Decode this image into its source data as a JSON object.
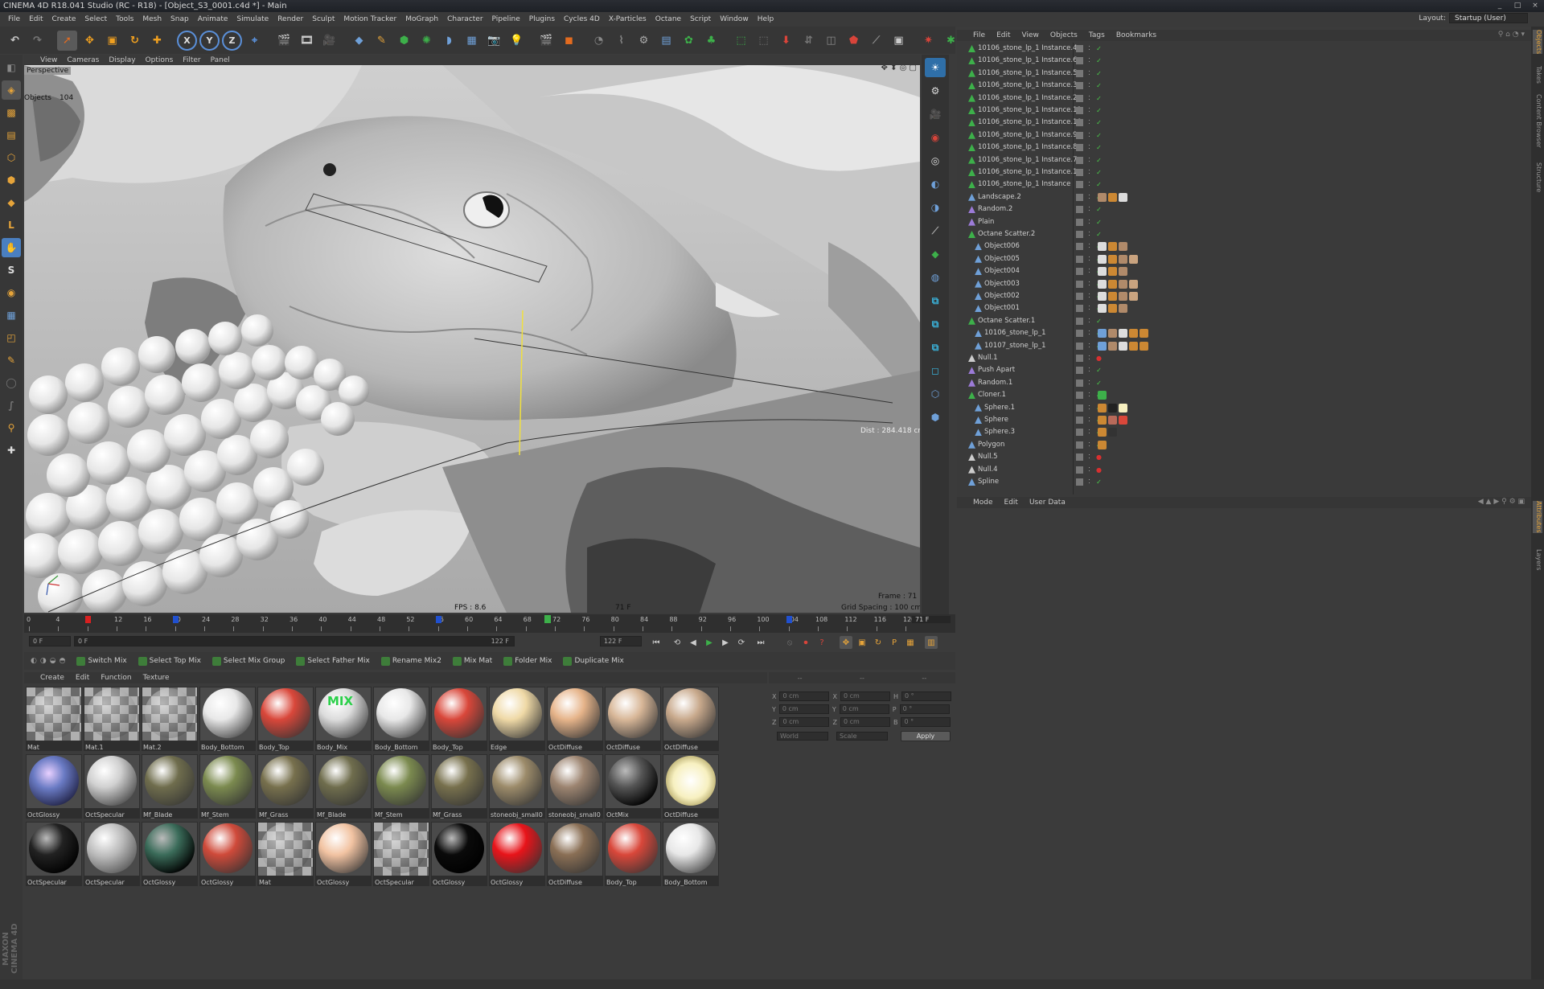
{
  "titlebar": {
    "title": "CINEMA 4D R18.041 Studio (RC - R18) - [Object_S3_0001.c4d *] - Main",
    "controls": [
      "_",
      "□",
      "×"
    ]
  },
  "menu": [
    "File",
    "Edit",
    "Create",
    "Select",
    "Tools",
    "Mesh",
    "Snap",
    "Animate",
    "Simulate",
    "Render",
    "Sculpt",
    "Motion Tracker",
    "MoGraph",
    "Character",
    "Pipeline",
    "Plugins",
    "Cycles 4D",
    "X-Particles",
    "Octane",
    "Script",
    "Window",
    "Help"
  ],
  "layout": {
    "label": "Layout:",
    "value": "Startup (User)"
  },
  "toolbar": {
    "axes": [
      "X",
      "Y",
      "Z"
    ]
  },
  "viewport": {
    "menu": [
      "View",
      "Cameras",
      "Display",
      "Options",
      "Filter",
      "Panel"
    ],
    "label": "Perspective",
    "hud_objects": "Objects",
    "hud_objects_count": "104",
    "dist": "Dist : 284.418 cm",
    "fps": "FPS : 8.6",
    "frame_mid": "71 F",
    "frame": "Frame : 71",
    "grid_spacing": "Grid Spacing : 100 cm"
  },
  "timeline": {
    "ticks": [
      "0",
      "4",
      "8",
      "12",
      "16",
      "20",
      "24",
      "28",
      "32",
      "36",
      "40",
      "44",
      "48",
      "52",
      "56",
      "60",
      "64",
      "68",
      "72",
      "76",
      "80",
      "84",
      "88",
      "92",
      "96",
      "100",
      "104",
      "108",
      "112",
      "116",
      "120"
    ],
    "current_frame": "71 F",
    "current_tick": "71",
    "key_red": 8,
    "key_blue_1": 20,
    "key_blue_2": 56,
    "key_blue_3": 104,
    "max_frame": 120,
    "current_value": 71
  },
  "transport": {
    "start": "0 F",
    "range_start": "0 F",
    "range_end": "122 F",
    "end": "122 F"
  },
  "mixbar": [
    "Switch Mix",
    "Select Top Mix",
    "Select Mix Group",
    "Select Father Mix",
    "Rename Mix2",
    "Mix Mat",
    "Folder Mix",
    "Duplicate Mix"
  ],
  "materials": {
    "menu": [
      "Create",
      "Edit",
      "Function",
      "Texture"
    ],
    "items": [
      {
        "name": "Mat",
        "color": "#8d8d8d",
        "type": "checker"
      },
      {
        "name": "Mat.1",
        "color": "#8d8d8d",
        "type": "checker"
      },
      {
        "name": "Mat.2",
        "color": "#8d8d8d",
        "type": "checker"
      },
      {
        "name": "Body_Bottom",
        "color": "#e8e8e8",
        "type": "rough"
      },
      {
        "name": "Body_Top",
        "color": "#d9473a",
        "type": "rough"
      },
      {
        "name": "Body_Mix",
        "color": "#dcdcdc",
        "type": "mix",
        "label": "MIX"
      },
      {
        "name": "Body_Bottom",
        "color": "#e8e8e8",
        "type": "rough"
      },
      {
        "name": "Body_Top",
        "color": "#d9473a",
        "type": "rough"
      },
      {
        "name": "Edge",
        "color": "#efd9a6",
        "type": "rough"
      },
      {
        "name": "OctDiffuse",
        "color": "#e6b48a",
        "type": "ball"
      },
      {
        "name": "OctDiffuse",
        "color": "#d8b798",
        "type": "ball"
      },
      {
        "name": "OctDiffuse",
        "color": "#c8a98c",
        "type": "ball"
      },
      {
        "name": "OctGlossy",
        "color": "#6a7bc4",
        "type": "space"
      },
      {
        "name": "OctSpecular",
        "color": "#d0d0d0",
        "type": "rough"
      },
      {
        "name": "Mf_Blade",
        "color": "#6f6d4d",
        "type": "ball"
      },
      {
        "name": "Mf_Stem",
        "color": "#7b8a4f",
        "type": "ball"
      },
      {
        "name": "Mf_Grass",
        "color": "#77704d",
        "type": "ball"
      },
      {
        "name": "Mf_Blade",
        "color": "#6f6d4d",
        "type": "ball"
      },
      {
        "name": "Mf_Stem",
        "color": "#7b8a4f",
        "type": "ball"
      },
      {
        "name": "Mf_Grass",
        "color": "#77704d",
        "type": "ball"
      },
      {
        "name": "stoneobj_small0",
        "color": "#9c8b6a",
        "type": "ball"
      },
      {
        "name": "stoneobj_small0",
        "color": "#9c8470",
        "type": "ball"
      },
      {
        "name": "OctMix",
        "color": "#555",
        "type": "dark"
      },
      {
        "name": "OctDiffuse",
        "color": "#f7f0c0",
        "type": "glow"
      },
      {
        "name": "OctSpecular",
        "color": "#222",
        "type": "dark"
      },
      {
        "name": "OctSpecular",
        "color": "#b8b8b8",
        "type": "glass"
      },
      {
        "name": "OctGlossy",
        "color": "#3b6c5a",
        "type": "dark"
      },
      {
        "name": "OctGlossy",
        "color": "#cf4a3a",
        "type": "ball"
      },
      {
        "name": "Mat",
        "color": "#8d8d8d",
        "type": "checker"
      },
      {
        "name": "OctGlossy",
        "color": "#f2c3a2",
        "type": "ball"
      },
      {
        "name": "OctSpecular",
        "color": "#8d8d8d",
        "type": "checker"
      },
      {
        "name": "OctGlossy",
        "color": "#0a0a0a",
        "type": "dark"
      },
      {
        "name": "OctGlossy",
        "color": "#e8141a",
        "type": "ball"
      },
      {
        "name": "OctDiffuse",
        "color": "#8a6f55",
        "type": "rough"
      },
      {
        "name": "Body_Top",
        "color": "#d9473a",
        "type": "rough"
      },
      {
        "name": "Body_Bottom",
        "color": "#e8e8e8",
        "type": "rough"
      }
    ]
  },
  "coords": {
    "header": [
      "--",
      "--",
      "--"
    ],
    "rows": [
      {
        "a": "X",
        "av": "0 cm",
        "b": "X",
        "bv": "0 cm",
        "c": "H",
        "cv": "0 °"
      },
      {
        "a": "Y",
        "av": "0 cm",
        "b": "Y",
        "bv": "0 cm",
        "c": "P",
        "cv": "0 °"
      },
      {
        "a": "Z",
        "av": "0 cm",
        "b": "Z",
        "bv": "0 cm",
        "c": "B",
        "cv": "0 °"
      }
    ],
    "world": "World",
    "scale": "Scale",
    "apply": "Apply"
  },
  "objects": {
    "menu": [
      "File",
      "Edit",
      "View",
      "Objects",
      "Tags",
      "Bookmarks"
    ],
    "rows": [
      {
        "name": "10106_stone_lp_1 Instance.4",
        "indent": 1,
        "icon": "#3db04a",
        "check": "✓"
      },
      {
        "name": "10106_stone_lp_1 Instance.6",
        "indent": 1,
        "icon": "#3db04a",
        "check": "✓"
      },
      {
        "name": "10106_stone_lp_1 Instance.5",
        "indent": 1,
        "icon": "#3db04a",
        "check": "✓"
      },
      {
        "name": "10106_stone_lp_1 Instance.3",
        "indent": 1,
        "icon": "#3db04a",
        "check": "✓"
      },
      {
        "name": "10106_stone_lp_1 Instance.2",
        "indent": 1,
        "icon": "#3db04a",
        "check": "✓"
      },
      {
        "name": "10106_stone_lp_1 Instance.11",
        "indent": 1,
        "icon": "#3db04a",
        "check": "✓"
      },
      {
        "name": "10106_stone_lp_1 Instance.10",
        "indent": 1,
        "icon": "#3db04a",
        "check": "✓"
      },
      {
        "name": "10106_stone_lp_1 Instance.9",
        "indent": 1,
        "icon": "#3db04a",
        "check": "✓"
      },
      {
        "name": "10106_stone_lp_1 Instance.8",
        "indent": 1,
        "icon": "#3db04a",
        "check": "✓"
      },
      {
        "name": "10106_stone_lp_1 Instance.7",
        "indent": 1,
        "icon": "#3db04a",
        "check": "✓"
      },
      {
        "name": "10106_stone_lp_1 Instance.1",
        "indent": 1,
        "icon": "#3db04a",
        "check": "✓"
      },
      {
        "name": "10106_stone_lp_1 Instance",
        "indent": 1,
        "icon": "#3db04a",
        "check": "✓"
      },
      {
        "name": "Landscape.2",
        "indent": 1,
        "icon": "#6fa0d8",
        "check": "✓",
        "tags": [
          "#b08a6a",
          "#cc8833",
          "#ddd"
        ]
      },
      {
        "name": "Random.2",
        "indent": 1,
        "icon": "#9c7bd8",
        "check": "✓"
      },
      {
        "name": "Plain",
        "indent": 1,
        "icon": "#9c7bd8",
        "check": "✓"
      },
      {
        "name": "Octane Scatter.2",
        "indent": 1,
        "icon": "#3db04a",
        "check": "✓"
      },
      {
        "name": "Object006",
        "indent": 2,
        "icon": "#6fa0d8",
        "check": "✓",
        "tags": [
          "#ddd",
          "#cc8833",
          "#b08a6a"
        ]
      },
      {
        "name": "Object005",
        "indent": 2,
        "icon": "#6fa0d8",
        "check": "✓",
        "tags": [
          "#ddd",
          "#cc8833",
          "#b08a6a",
          "#c9a37f"
        ]
      },
      {
        "name": "Object004",
        "indent": 2,
        "icon": "#6fa0d8",
        "check": "✓",
        "tags": [
          "#ddd",
          "#cc8833",
          "#b08a6a"
        ]
      },
      {
        "name": "Object003",
        "indent": 2,
        "icon": "#6fa0d8",
        "check": "✓",
        "tags": [
          "#ddd",
          "#cc8833",
          "#b08a6a",
          "#c9a37f"
        ]
      },
      {
        "name": "Object002",
        "indent": 2,
        "icon": "#6fa0d8",
        "check": "✓",
        "tags": [
          "#ddd",
          "#cc8833",
          "#b08a6a",
          "#c9a37f"
        ]
      },
      {
        "name": "Object001",
        "indent": 2,
        "icon": "#6fa0d8",
        "check": "✓",
        "tags": [
          "#ddd",
          "#cc8833",
          "#b08a6a"
        ]
      },
      {
        "name": "Octane Scatter.1",
        "indent": 1,
        "icon": "#3db04a",
        "check": "✓"
      },
      {
        "name": "10106_stone_lp_1",
        "indent": 2,
        "icon": "#6fa0d8",
        "check": "✓",
        "tags": [
          "#6fa0d8",
          "#b08a6a",
          "#ddd",
          "#cc8833",
          "#cc8833"
        ]
      },
      {
        "name": "10107_stone_lp_1",
        "indent": 2,
        "icon": "#6fa0d8",
        "check": "✓",
        "tags": [
          "#6fa0d8",
          "#b08a6a",
          "#ddd",
          "#cc8833",
          "#cc8833"
        ]
      },
      {
        "name": "Null.1",
        "indent": 1,
        "icon": "#cccccc",
        "check": "●"
      },
      {
        "name": "Push Apart",
        "indent": 1,
        "icon": "#9c7bd8",
        "check": "✓"
      },
      {
        "name": "Random.1",
        "indent": 1,
        "icon": "#9c7bd8",
        "check": "✓"
      },
      {
        "name": "Cloner.1",
        "indent": 1,
        "icon": "#3db04a",
        "check": "✓",
        "tags": [
          "#3db04a"
        ]
      },
      {
        "name": "Sphere.1",
        "indent": 2,
        "icon": "#6fa0d8",
        "check": "✓",
        "tags": [
          "#cc8833",
          "#222",
          "#f7f0c0"
        ]
      },
      {
        "name": "Sphere",
        "indent": 2,
        "icon": "#6fa0d8",
        "check": "✓",
        "tags": [
          "#cc8833",
          "#b86a5a",
          "#d9473a"
        ]
      },
      {
        "name": "Sphere.3",
        "indent": 2,
        "icon": "#6fa0d8",
        "check": "✓",
        "tags": [
          "#cc8833",
          "#333"
        ]
      },
      {
        "name": "Polygon",
        "indent": 1,
        "icon": "#6fa0d8",
        "check": "✓",
        "tags": [
          "#cc8833"
        ]
      },
      {
        "name": "Null.5",
        "indent": 1,
        "icon": "#cccccc",
        "check": "●"
      },
      {
        "name": "Null.4",
        "indent": 1,
        "icon": "#cccccc",
        "check": "●"
      },
      {
        "name": "Spline",
        "indent": 1,
        "icon": "#6fa0d8",
        "check": "✓"
      }
    ]
  },
  "attributes": {
    "menu": [
      "Mode",
      "Edit",
      "User Data"
    ]
  },
  "sidetabs": [
    "Objects",
    "Takes",
    "Content Browser",
    "Structure"
  ],
  "sidetabs2": [
    "Attributes",
    "Layers"
  ],
  "watermark": "MAXON CINEMA 4D"
}
